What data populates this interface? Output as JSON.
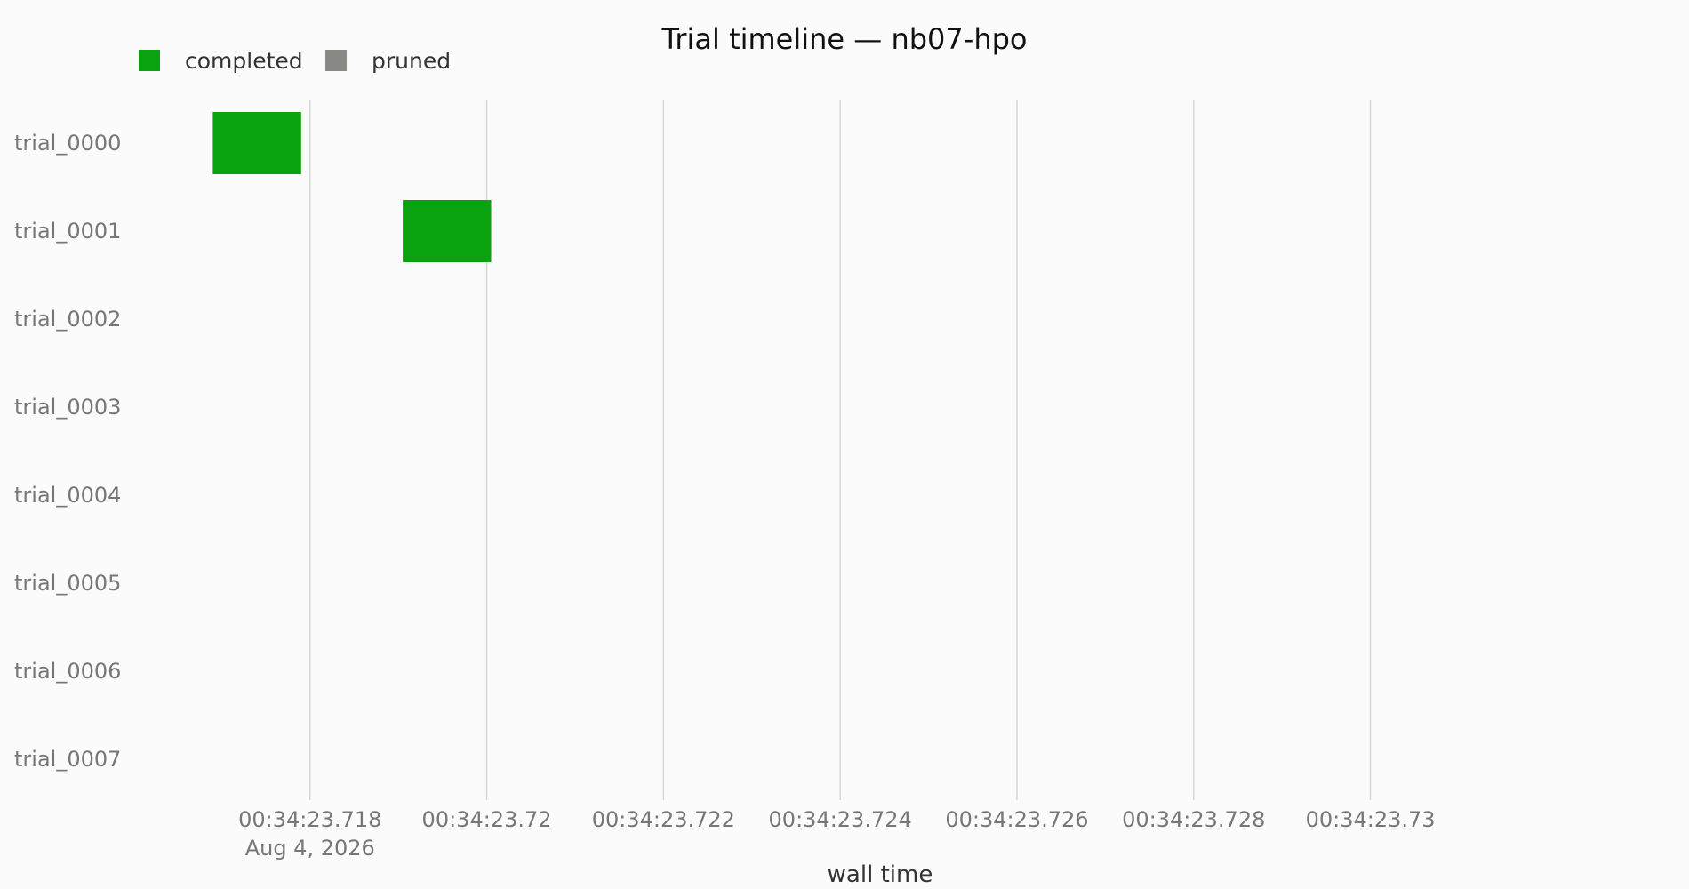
{
  "chart_data": {
    "type": "bar",
    "subtype": "timeline",
    "title": "Trial timeline — nb07-hpo",
    "xlabel": "wall time",
    "ylabel": "",
    "x_date_label": "Aug 4, 2026",
    "x_ticks": [
      "00:34:23.718",
      "00:34:23.72",
      "00:34:23.722",
      "00:34:23.724",
      "00:34:23.726",
      "00:34:23.728",
      "00:34:23.73"
    ],
    "x_tick_values": [
      23.718,
      23.72,
      23.722,
      23.724,
      23.726,
      23.728,
      23.73
    ],
    "xlim": [
      23.7159,
      23.7326
    ],
    "x_units": "seconds past 00:34 on Aug 4, 2026",
    "categories": [
      "trial_0000",
      "trial_0001",
      "trial_0002",
      "trial_0003",
      "trial_0004",
      "trial_0005",
      "trial_0006",
      "trial_0007"
    ],
    "grid": "vertical",
    "legend_position": "top-left",
    "legend": [
      {
        "name": "completed",
        "color": "#0aa30f"
      },
      {
        "name": "pruned",
        "color": "#888884"
      }
    ],
    "series": [
      {
        "name": "completed",
        "color": "#0aa30f",
        "intervals": [
          {
            "trial": "trial_0000",
            "start": 23.7169,
            "end": 23.7179
          },
          {
            "trial": "trial_0001",
            "start": 23.71905,
            "end": 23.72005
          }
        ]
      },
      {
        "name": "pruned",
        "color": "#888884",
        "intervals": []
      }
    ]
  }
}
